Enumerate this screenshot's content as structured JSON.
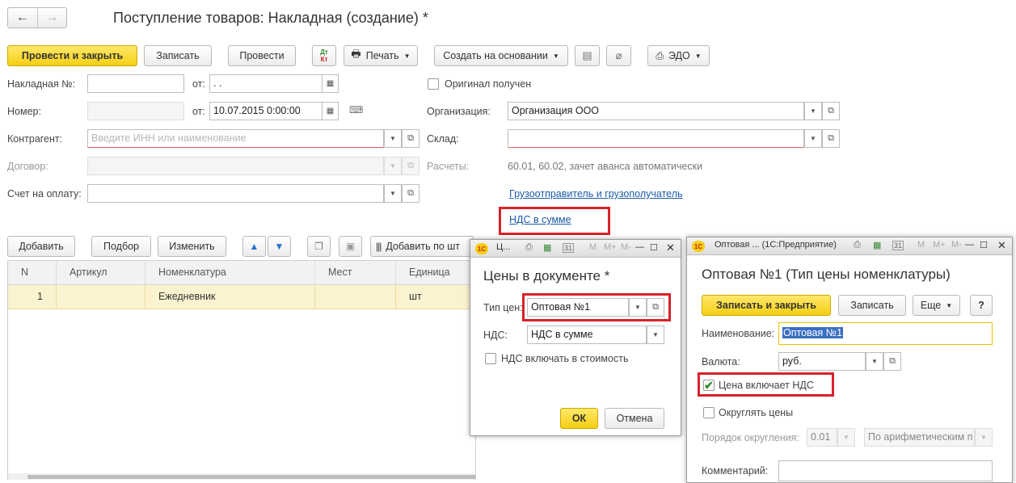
{
  "nav": {
    "back": "←",
    "forward": "→"
  },
  "title": "Поступление товаров: Накладная (создание) *",
  "toolbar": {
    "post_close": "Провести и закрыть",
    "save": "Записать",
    "post": "Провести",
    "dtkt": "Дт Кт",
    "print": "Печать",
    "create_based": "Создать на основании",
    "edo": "ЭДО"
  },
  "form": {
    "invoice_no_label": "Накладная №:",
    "from_label": "от:",
    "invoice_date": " .  .",
    "number_label": "Номер:",
    "number_date": "10.07.2015  0:00:00",
    "counterparty_label": "Контрагент:",
    "counterparty_placeholder": "Введите ИНН или наименование",
    "contract_label": "Договор:",
    "payment_invoice_label": "Счет на оплату:",
    "original_received": "Оригинал получен",
    "organization_label": "Организация:",
    "organization_value": "Организация ООО",
    "warehouse_label": "Склад:",
    "settlements_label": "Расчеты:",
    "settlements_value": "60.01, 60.02, зачет аванса автоматически",
    "shipper_link": "Грузоотправитель и грузополучатель",
    "vat_link": "НДС в сумме"
  },
  "table_toolbar": {
    "add": "Добавить",
    "selection": "Подбор",
    "change": "Изменить",
    "add_by_barcode": "Добавить по шт"
  },
  "table": {
    "columns": [
      "N",
      "Артикул",
      "Номенклатура",
      "Мест",
      "Единица"
    ],
    "rows": [
      {
        "n": "1",
        "article": "",
        "nomenclature": "Ежедневник",
        "places": "",
        "unit": "шт"
      }
    ]
  },
  "prices_dialog": {
    "title_short": "Ц...",
    "heading": "Цены в документе *",
    "price_type_label": "Тип цен:",
    "price_type_value": "Оптовая №1",
    "vat_label": "НДС:",
    "vat_value": "НДС в сумме",
    "vat_include": "НДС включать в стоимость",
    "ok": "ОК",
    "cancel": "Отмена"
  },
  "price_type_window": {
    "title": "Оптовая ...  (1С:Предприятие)",
    "heading": "Оптовая №1 (Тип цены номенклатуры)",
    "save_close": "Записать и закрыть",
    "save": "Записать",
    "more": "Еще",
    "help": "?",
    "name_label": "Наименование:",
    "name_value": "Оптовая №1",
    "currency_label": "Валюта:",
    "currency_value": "руб.",
    "price_includes_vat": "Цена включает НДС",
    "round_prices": "Округлять цены",
    "rounding_order_label": "Порядок округления:",
    "rounding_order_value": "0.01",
    "rounding_method_value": "По арифметическим п",
    "comment_label": "Комментарий:"
  },
  "title_icons": {
    "m": "M",
    "mplus": "M+",
    "mminus": "M-",
    "cal": "31"
  },
  "colors": {
    "accent_yellow": "#f5cf14",
    "highlight_red": "#d8222a",
    "link_blue": "#1d5aa7",
    "row_selected": "#fbf3cf"
  }
}
